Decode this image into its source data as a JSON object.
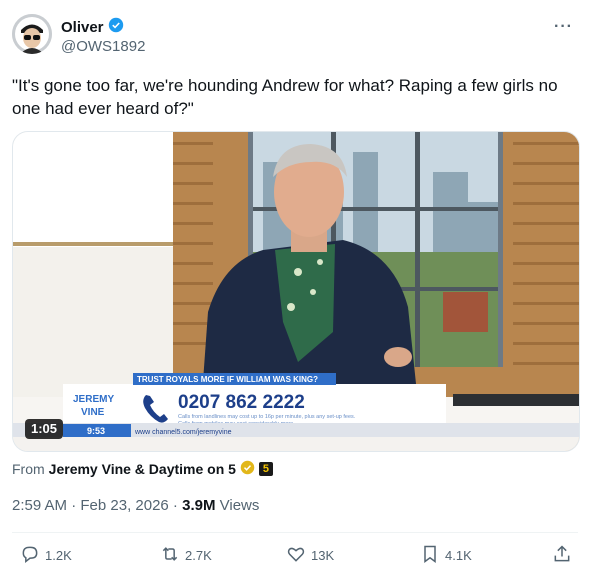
{
  "author": {
    "name": "Oliver",
    "handle": "@OWS1892",
    "verified_color": "#1d9bf0"
  },
  "more_label": "···",
  "tweet_text": "\"It's gone too far, we're hounding Andrew for what? Raping a few girls no one had ever heard of?\"",
  "video": {
    "duration": "1:05",
    "clock": "9:53",
    "banner_title": "TRUST ROYALS MORE IF WILLIAM WAS KING?",
    "phone": "0207 862 2222",
    "fine_print_1": "Calls from landlines may cost up to 16p per minute, plus any set-up fees.",
    "fine_print_2": "Calls from mobiles may cost considerably more.",
    "website": "www  channel5.com/jeremyvine",
    "logo_top": "JEREMY",
    "logo_bottom": "VINE"
  },
  "source": {
    "prefix": "From",
    "name": "Jeremy Vine & Daytime on 5",
    "badge": "5"
  },
  "meta": {
    "time": "2:59 AM · Feb 23, 2026 · ",
    "views_count": "3.9M",
    "views_label": " Views"
  },
  "actions": {
    "replies": "1.2K",
    "reposts": "2.7K",
    "likes": "13K",
    "bookmarks": "4.1K"
  }
}
